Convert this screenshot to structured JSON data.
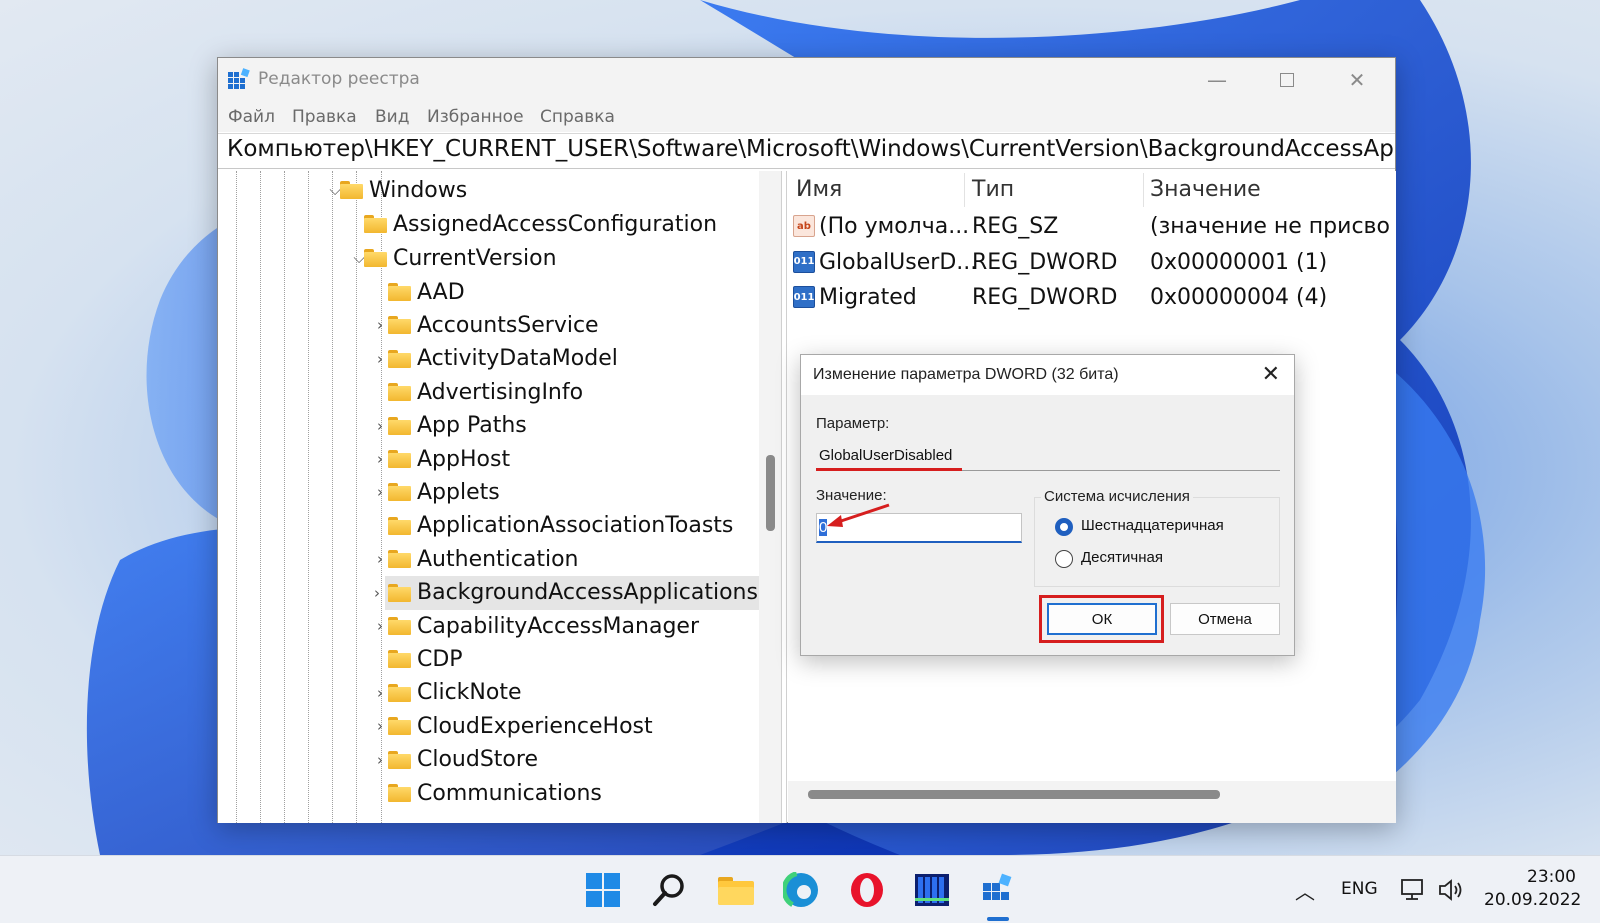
{
  "window": {
    "title": "Редактор реестра",
    "menu": [
      "Файл",
      "Правка",
      "Вид",
      "Избранное",
      "Справка"
    ],
    "address": "Компьютер\\HKEY_CURRENT_USER\\Software\\Microsoft\\Windows\\CurrentVersion\\BackgroundAccessApplicatio"
  },
  "tree": {
    "windows": "Windows",
    "assigned": "AssignedAccessConfiguration",
    "current_version": "CurrentVersion",
    "children": [
      {
        "label": "AAD",
        "expandable": false
      },
      {
        "label": "AccountsService",
        "expandable": true
      },
      {
        "label": "ActivityDataModel",
        "expandable": true
      },
      {
        "label": "AdvertisingInfo",
        "expandable": false
      },
      {
        "label": "App Paths",
        "expandable": true
      },
      {
        "label": "AppHost",
        "expandable": true
      },
      {
        "label": "Applets",
        "expandable": true
      },
      {
        "label": "ApplicationAssociationToasts",
        "expandable": false
      },
      {
        "label": "Authentication",
        "expandable": true
      },
      {
        "label": "BackgroundAccessApplications",
        "expandable": true,
        "selected": true
      },
      {
        "label": "CapabilityAccessManager",
        "expandable": true
      },
      {
        "label": "CDP",
        "expandable": false
      },
      {
        "label": "ClickNote",
        "expandable": true
      },
      {
        "label": "CloudExperienceHost",
        "expandable": true
      },
      {
        "label": "CloudStore",
        "expandable": true
      },
      {
        "label": "Communications",
        "expandable": false
      }
    ]
  },
  "list": {
    "headers": {
      "name": "Имя",
      "type": "Тип",
      "value": "Значение"
    },
    "rows": [
      {
        "icon": "string-value-icon",
        "badge": "ab",
        "name": "(По умолча...",
        "type": "REG_SZ",
        "value": "(значение не присво"
      },
      {
        "icon": "dword-value-icon",
        "badge": "011",
        "name": "GlobalUserD...",
        "type": "REG_DWORD",
        "value": "0x00000001 (1)"
      },
      {
        "icon": "dword-value-icon",
        "badge": "011",
        "name": "Migrated",
        "type": "REG_DWORD",
        "value": "0x00000004 (4)"
      }
    ]
  },
  "dialog": {
    "title": "Изменение параметра DWORD (32 бита)",
    "param_label": "Параметр:",
    "param_value": "GlobalUserDisabled",
    "value_label": "Значение:",
    "value": "0",
    "base_group": "Система исчисления",
    "hex_label": "Шестнадцатеричная",
    "dec_label": "Десятичная",
    "hex_selected": true,
    "ok": "ОК",
    "cancel": "Отмена"
  },
  "taskbar": {
    "lang": "ENG",
    "time": "23:00",
    "date": "20.09.2022"
  },
  "colors": {
    "accent": "#1f6fd0",
    "annotation_red": "#d61e1e",
    "folder": "#f5c242"
  }
}
